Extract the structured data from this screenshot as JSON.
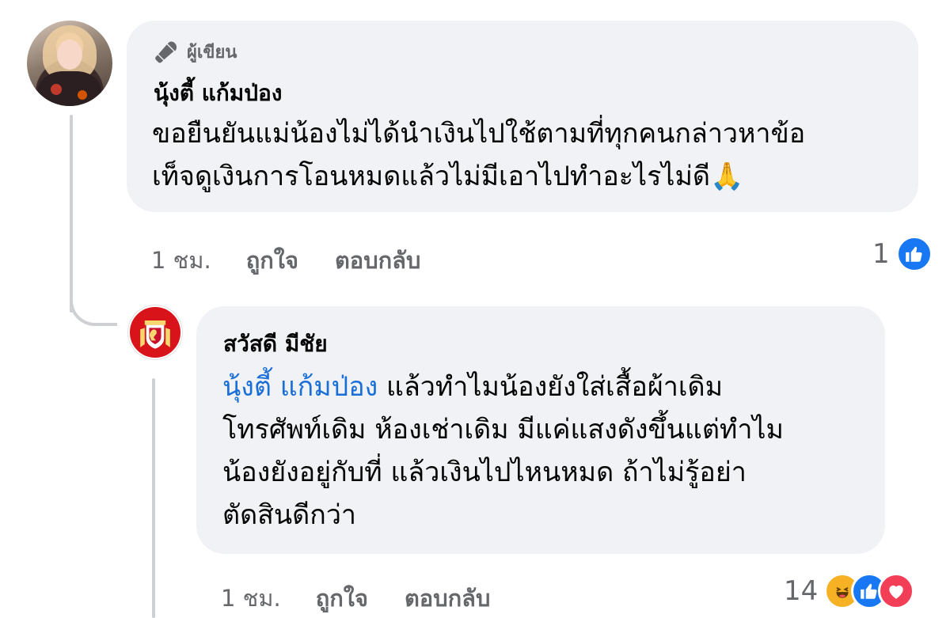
{
  "comments": [
    {
      "author_badge": "ผู้เขียน",
      "name": "นุ้งตี้ แก้มป่อง",
      "text_lines": [
        "ขอยืนยันแม่น้องไม่ได้นำเงินไปใช้ตามที่ทุกคนกล่าวหาข้อ",
        "เท็จดูเงินการโอนหมดแล้วไม่มีเอาไปทำอะไรไม่ดี🙏"
      ],
      "time": "1 ชม.",
      "like_label": "ถูกใจ",
      "reply_label": "ตอบกลับ",
      "reaction_count": "1",
      "reactions": [
        "like"
      ]
    },
    {
      "name": "สวัสดี มีชัย",
      "mention": "นุ้งตี้ แก้มป่อง",
      "text_lines": [
        " แล้วทำไมน้องยังใส่เสื้อผ้าเดิม",
        "โทรศัพท์เดิม ห้องเช่าเดิม มีแค่แสงดังขึ้นแต่ทำไม",
        "น้องยังอยู่กับที่ แล้วเงินไปไหนหมด ถ้าไม่รู้อย่า",
        "ตัดสินดีกว่า"
      ],
      "time": "1 ชม.",
      "like_label": "ถูกใจ",
      "reply_label": "ตอบกลับ",
      "reaction_count": "14",
      "reactions": [
        "haha",
        "like",
        "love"
      ]
    }
  ],
  "icons": {
    "author_badge": "microphone-icon",
    "reactions": [
      "haha-icon",
      "like-icon",
      "love-icon"
    ]
  },
  "colors": {
    "bubble": "#f0f2f5",
    "secondary_text": "#65676b",
    "mention": "#1a6fd6",
    "like": "#1877f2",
    "love": "#f33e58",
    "haha": "#f7b125"
  }
}
